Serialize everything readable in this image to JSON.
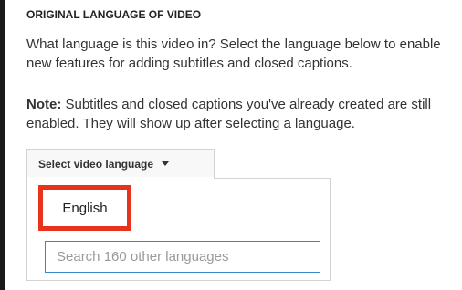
{
  "section": {
    "heading": "ORIGINAL LANGUAGE OF VIDEO",
    "description": "What language is this video in? Select the language below to enable new features for adding subtitles and closed captions.",
    "note_label": "Note:",
    "note_text": " Subtitles and closed captions you've already created are still enabled. They will show up after selecting a language."
  },
  "language_select": {
    "button_label": "Select video language",
    "caret_icon": "chevron-down-icon",
    "options": [
      {
        "label": "English",
        "highlighted": true,
        "highlight_color": "#e8331c"
      }
    ],
    "search": {
      "value": "",
      "placeholder": "Search 160 other languages"
    }
  },
  "colors": {
    "accent_border": "#3a87c7",
    "highlight": "#e8331c"
  }
}
